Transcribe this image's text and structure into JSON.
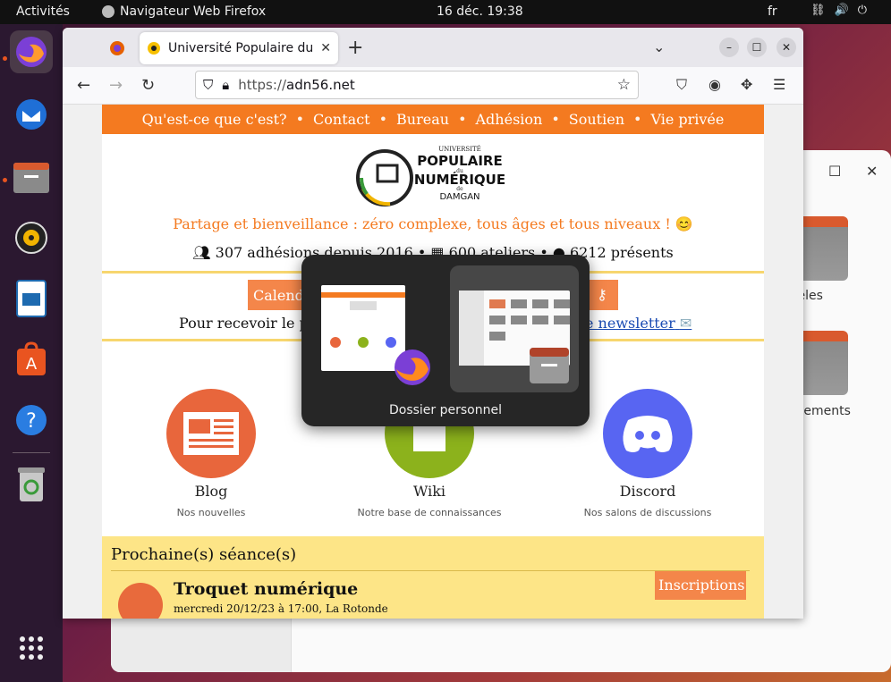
{
  "topbar": {
    "activities": "Activités",
    "app_name": "Navigateur Web Firefox",
    "clock": "16 déc.  19:38",
    "language": "fr"
  },
  "dock": {
    "items": [
      "firefox-icon",
      "thunderbird-icon",
      "files-icon",
      "rhythmbox-icon",
      "libreoffice-impress-icon",
      "app-center-icon",
      "help-icon",
      "trash-icon",
      "app-grid-icon"
    ]
  },
  "bg_window": {
    "folder1_label": "odèles",
    "folder2_label": "rgements"
  },
  "browser": {
    "tab_title": "Université Populaire du N",
    "url_proto": "https://",
    "url_host": "adn56.net"
  },
  "site": {
    "menu": [
      "Qu'est-ce que c'est?",
      "Contact",
      "Bureau",
      "Adhésion",
      "Soutien",
      "Vie privée"
    ],
    "logo": {
      "line1": "UNIVERSITÉ",
      "line2": "POPULAIRE",
      "line3": "du",
      "line4": "NUMÉRIQUE",
      "line5": "de",
      "line6": "DAMGAN"
    },
    "tagline": "Partage et bienveillance : zéro complexe, tous âges et tous niveaux ! 😊",
    "stats": {
      "members": "307 adhésions depuis 2016",
      "workshops": "600 ateliers",
      "present": "6212 présents"
    },
    "calendar_btn": "Calend",
    "newsletter_text": "Pour recevoir le pr",
    "newsletter_link": "e newsletter",
    "cards": [
      {
        "name": "Blog",
        "desc": "Nos nouvelles"
      },
      {
        "name": "Wiki",
        "desc": "Notre base de connaissances"
      },
      {
        "name": "Discord",
        "desc": "Nos salons de discussions"
      }
    ],
    "sessions": {
      "heading": "Prochaine(s) séance(s)",
      "register": "Inscriptions",
      "event_title": "Troquet numérique",
      "event_date": "mercredi 20/12/23 à 17:00, La Rotonde"
    }
  },
  "switcher": {
    "label": "Dossier personnel"
  },
  "colors": {
    "accent": "#f47a20",
    "ubuntu_orange": "#e95420"
  }
}
